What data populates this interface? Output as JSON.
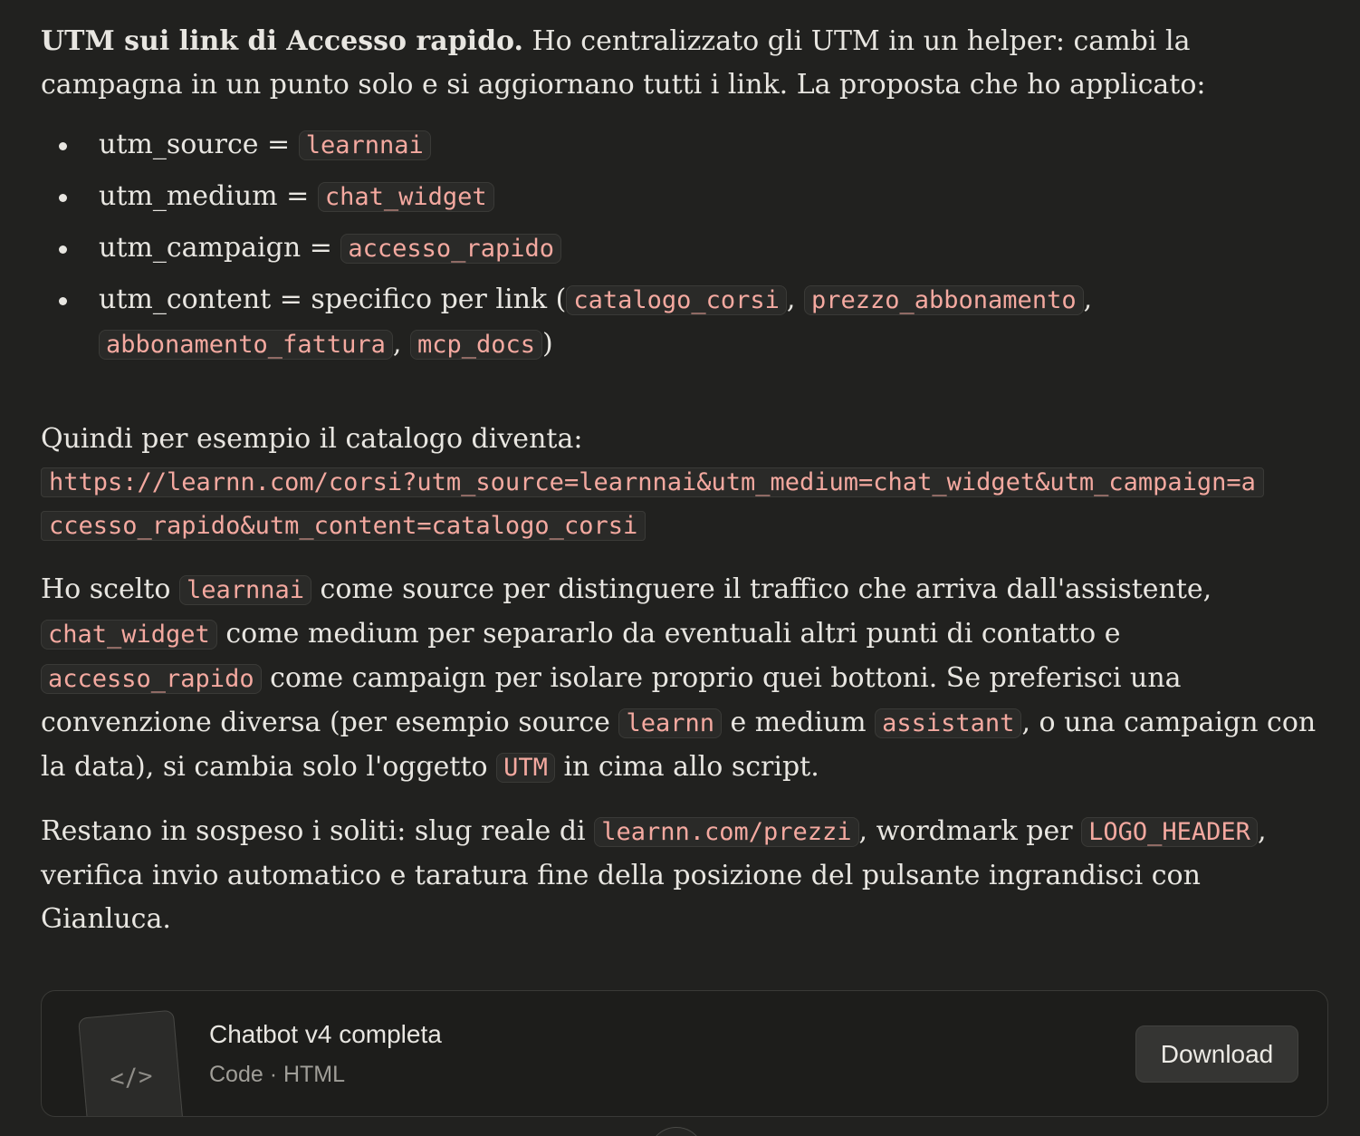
{
  "intro": {
    "bold": "UTM sui link di Accesso rapido.",
    "text": " Ho centralizzato gli UTM in un helper: cambi la campagna in un punto solo e si aggiornano tutti i link. La proposta che ho applicato:"
  },
  "utm_list": [
    {
      "label": "utm_source = ",
      "value": "learnnai"
    },
    {
      "label": "utm_medium = ",
      "value": "chat_widget"
    },
    {
      "label": "utm_campaign = ",
      "value": "accesso_rapido"
    }
  ],
  "utm_content": {
    "label": "utm_content = specifico per link (",
    "values": [
      "catalogo_corsi",
      "prezzo_abbonamento",
      "abbonamento_fattura",
      "mcp_docs"
    ],
    "sep": ", ",
    "close": ")"
  },
  "example": {
    "text": "Quindi per esempio il catalogo diventa:",
    "url": "https://learnn.com/corsi?utm_source=learnnai&utm_medium=chat_widget&utm_campaign=accesso_rapido&utm_content=catalogo_corsi"
  },
  "choice": {
    "t1": "Ho scelto ",
    "c1": "learnnai",
    "t2": " come source per distinguere il traffico che arriva dall'assistente, ",
    "c2": "chat_widget",
    "t3": " come medium per separarlo da eventuali altri punti di contatto e ",
    "c3": "accesso_rapido",
    "t4": " come campaign per isolare proprio quei bottoni. Se preferisci una convenzione diversa (per esempio source ",
    "c4": "learnn",
    "t5": " e medium ",
    "c5": "assistant",
    "t6": ", o una campaign con la data), si cambia solo l'oggetto ",
    "c6": "UTM",
    "t7": " in cima allo script."
  },
  "pending": {
    "t1": "Restano in sospeso i soliti: slug reale di ",
    "c1": "learnn.com/prezzi",
    "t2": ", wordmark per ",
    "c2": "LOGO_HEADER",
    "t3": ", verifica invio automatico e taratura fine della posizione del pulsante ingrandisci con Gianluca."
  },
  "artifact": {
    "icon": "code-icon",
    "icon_glyph": "</>",
    "title": "Chatbot v4 completa",
    "meta": "Code · HTML",
    "download_label": "Download"
  }
}
